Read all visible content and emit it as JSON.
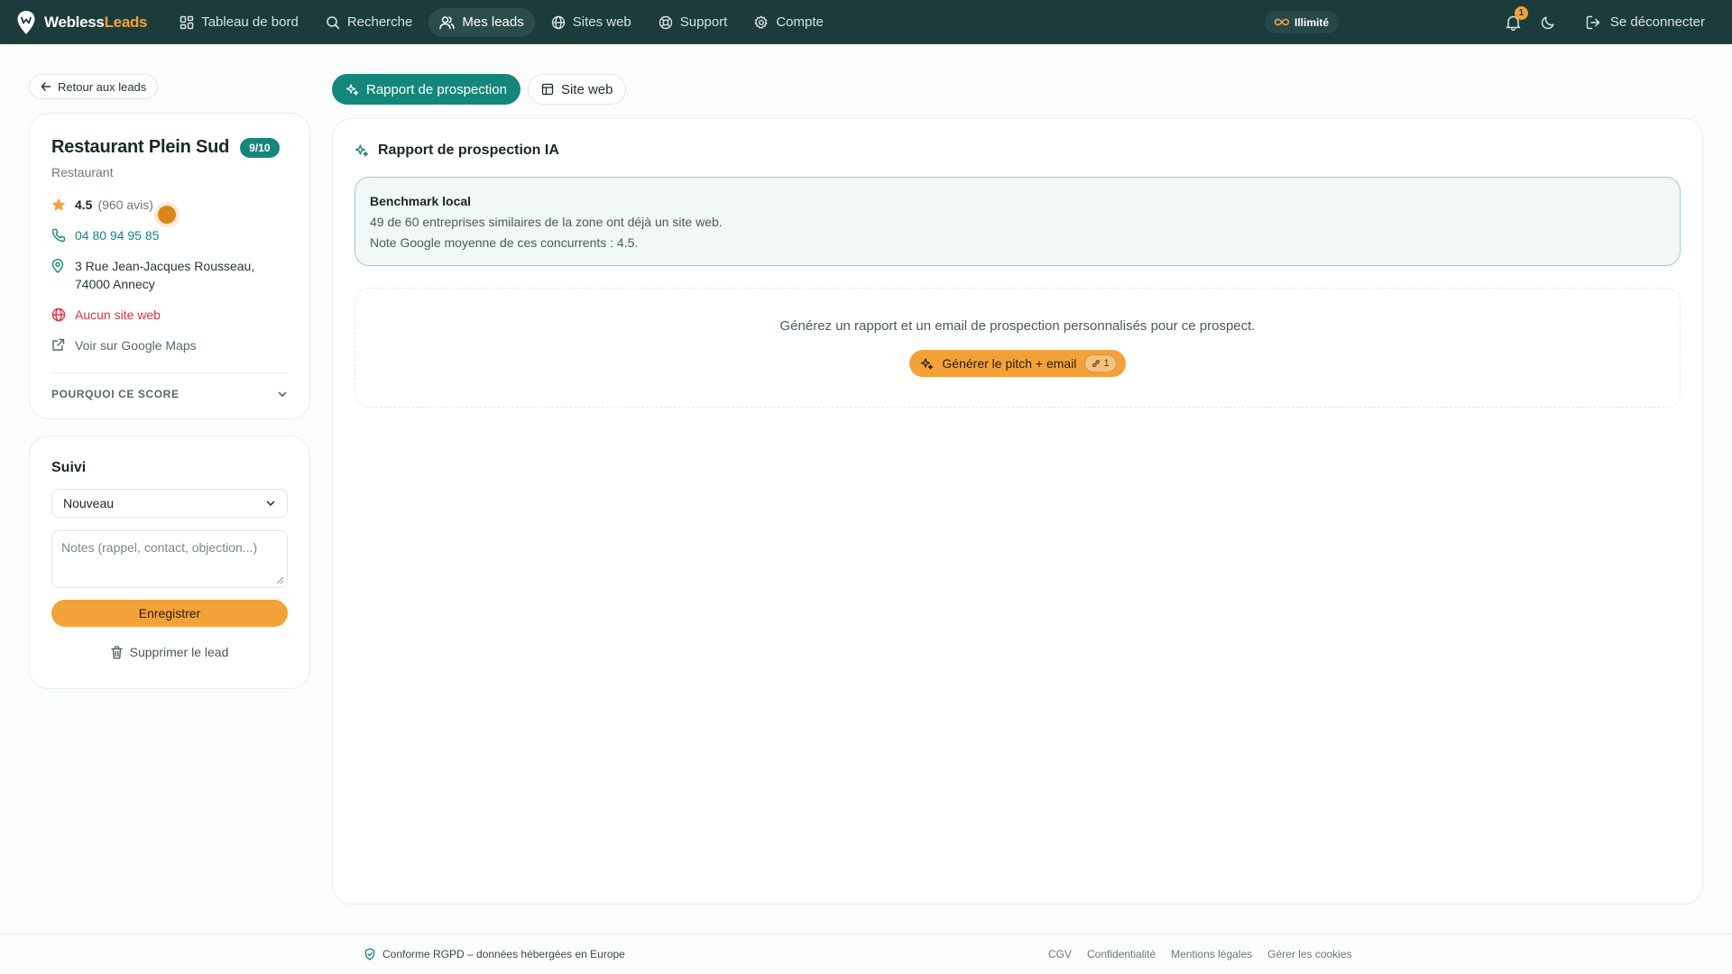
{
  "brand": {
    "part1": "Webless",
    "part2": "Leads"
  },
  "nav": {
    "items": [
      {
        "label": "Tableau de bord",
        "icon": "dashboard-icon"
      },
      {
        "label": "Recherche",
        "icon": "search-icon"
      },
      {
        "label": "Mes leads",
        "icon": "users-icon",
        "active": true
      },
      {
        "label": "Sites web",
        "icon": "globe-icon"
      },
      {
        "label": "Support",
        "icon": "lifebuoy-icon"
      },
      {
        "label": "Compte",
        "icon": "gear-icon"
      }
    ],
    "plan_label": "Illimité",
    "notification_count": "1",
    "logout_label": "Se déconnecter"
  },
  "back_label": "Retour aux leads",
  "lead": {
    "name": "Restaurant Plein Sud",
    "score": "9/10",
    "category": "Restaurant",
    "rating": "4.5",
    "reviews": "(960 avis)",
    "phone": "04 80 94 95 85",
    "address_line1": "3 Rue Jean-Jacques Rousseau,",
    "address_line2": "74000 Annecy",
    "website_status": "Aucun site web",
    "maps_link": "Voir sur Google Maps",
    "why_score": "POURQUOI CE SCORE"
  },
  "follow": {
    "title": "Suivi",
    "status_value": "Nouveau",
    "notes_placeholder": "Notes (rappel, contact, objection...)",
    "save_label": "Enregistrer",
    "delete_label": "Supprimer le lead"
  },
  "tabs": [
    {
      "label": "Rapport de prospection",
      "active": true
    },
    {
      "label": "Site web",
      "active": false
    }
  ],
  "report": {
    "title": "Rapport de prospection IA",
    "benchmark_title": "Benchmark local",
    "benchmark_line1": "49 de 60 entreprises similaires de la zone ont déjà un site web.",
    "benchmark_line2": "Note Google moyenne de ces concurrents : 4.5.",
    "generate_desc": "Générez un rapport et un email de prospection personnalisés pour ce prospect.",
    "generate_label": "Générer le pitch + email",
    "credit_cost": "1"
  },
  "footer": {
    "rgpd": "Conforme RGPD – données hébergées en Europe",
    "links": [
      "CGV",
      "Confidentialité",
      "Mentions légales",
      "Gérer les cookies"
    ]
  },
  "colors": {
    "nav_bg": "#1c3b3b",
    "accent_teal": "#15877a",
    "accent_orange": "#f3a23a",
    "danger": "#d9363e"
  }
}
